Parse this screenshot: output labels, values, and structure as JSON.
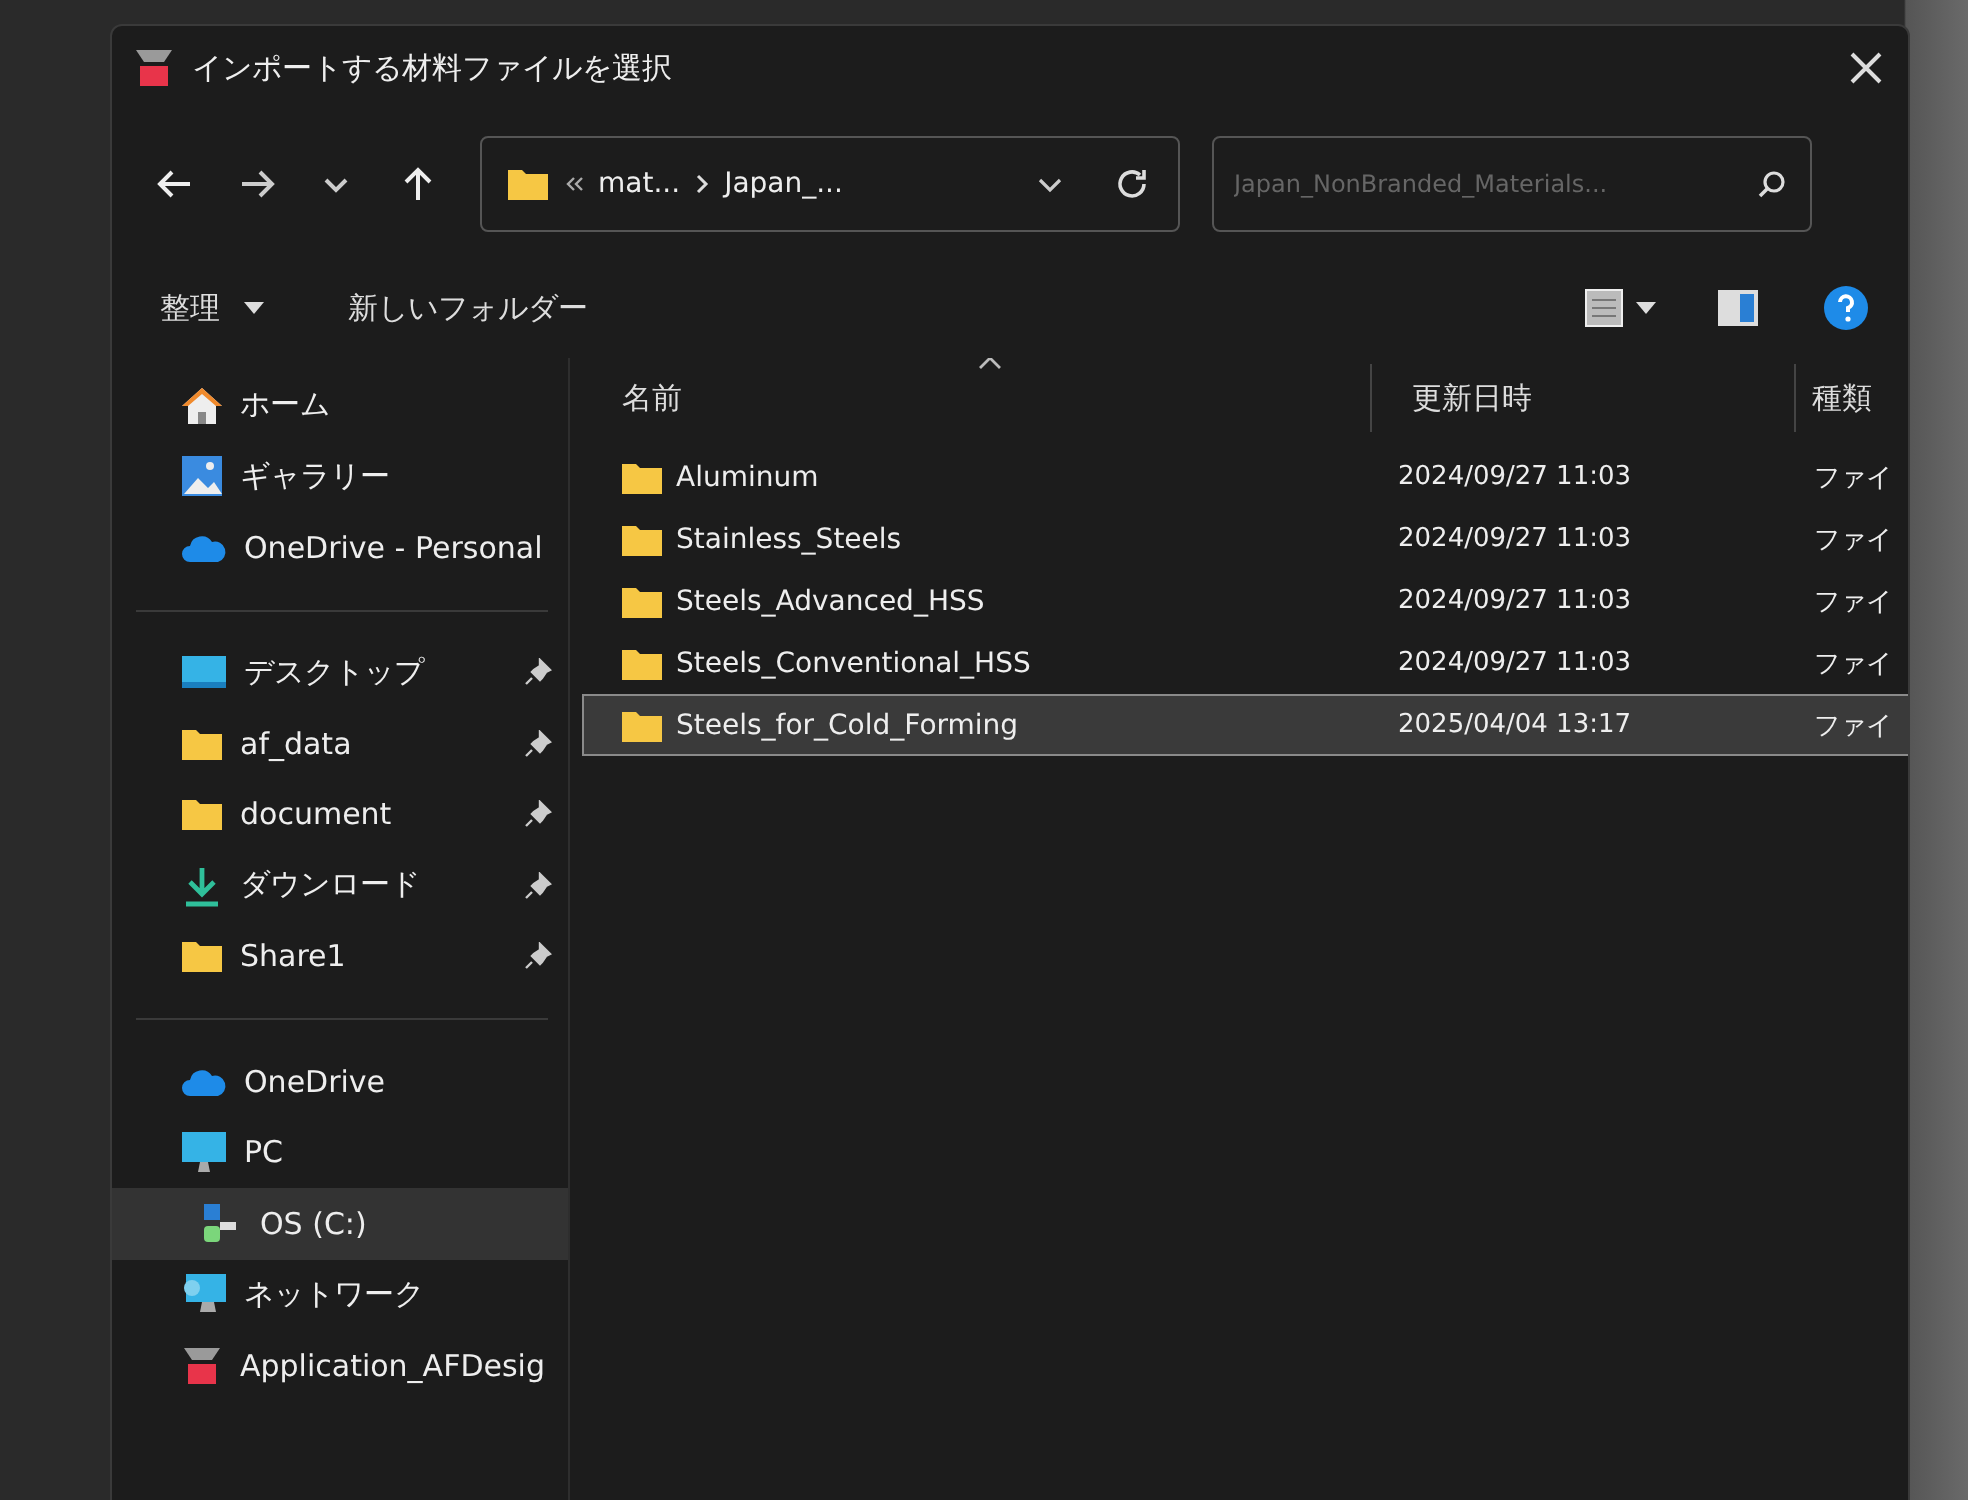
{
  "window": {
    "title": "インポートする材料ファイルを選択"
  },
  "address": {
    "path": [
      "mat...",
      "Japan_..."
    ]
  },
  "search": {
    "placeholder": "Japan_NonBranded_Materials..."
  },
  "toolbar": {
    "organize": "整理",
    "new_folder": "新しいフォルダー"
  },
  "sidebar": {
    "sections": [
      [
        {
          "kind": "home",
          "label": "ホーム",
          "pinned": false,
          "selected": false
        },
        {
          "kind": "gallery",
          "label": "ギャラリー",
          "pinned": false,
          "selected": false
        },
        {
          "kind": "cloud",
          "label": "OneDrive - Personal",
          "pinned": false,
          "selected": false
        }
      ],
      [
        {
          "kind": "desktop",
          "label": "デスクトップ",
          "pinned": true,
          "selected": false
        },
        {
          "kind": "folder",
          "label": "af_data",
          "pinned": true,
          "selected": false
        },
        {
          "kind": "folder",
          "label": "document",
          "pinned": true,
          "selected": false
        },
        {
          "kind": "download",
          "label": "ダウンロード",
          "pinned": true,
          "selected": false
        },
        {
          "kind": "folder",
          "label": "Share1",
          "pinned": true,
          "selected": false
        }
      ],
      [
        {
          "kind": "cloud",
          "label": "OneDrive",
          "pinned": false,
          "selected": false,
          "indented": false
        },
        {
          "kind": "pc",
          "label": "PC",
          "pinned": false,
          "selected": false,
          "indented": false
        },
        {
          "kind": "drive",
          "label": "OS (C:)",
          "pinned": false,
          "selected": true,
          "indented": true
        },
        {
          "kind": "network",
          "label": "ネットワーク",
          "pinned": false,
          "selected": false,
          "indented": false
        },
        {
          "kind": "app",
          "label": "Application_AFDesig",
          "pinned": false,
          "selected": false,
          "indented": false
        }
      ]
    ]
  },
  "table": {
    "columns": [
      "名前",
      "更新日時",
      "種類"
    ],
    "rows": [
      {
        "name": "Aluminum",
        "modified": "2024/09/27 11:03",
        "type": "ファイ",
        "selected": false
      },
      {
        "name": "Stainless_Steels",
        "modified": "2024/09/27 11:03",
        "type": "ファイ",
        "selected": false
      },
      {
        "name": "Steels_Advanced_HSS",
        "modified": "2024/09/27 11:03",
        "type": "ファイ",
        "selected": false
      },
      {
        "name": "Steels_Conventional_HSS",
        "modified": "2024/09/27 11:03",
        "type": "ファイ",
        "selected": false
      },
      {
        "name": "Steels_for_Cold_Forming",
        "modified": "2025/04/04 13:17",
        "type": "ファイ",
        "selected": true
      }
    ]
  }
}
